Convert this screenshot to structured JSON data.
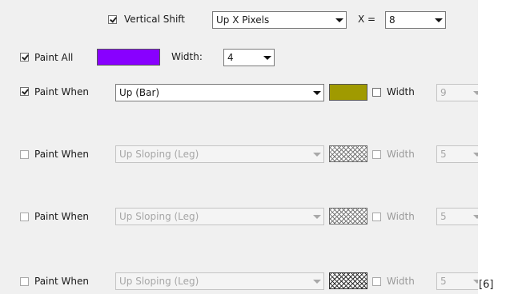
{
  "vertical_shift": {
    "checked": true,
    "label": "Vertical Shift",
    "direction_value": "Up X Pixels",
    "x_label": "X =",
    "x_value": "8"
  },
  "paint_all": {
    "checked": true,
    "label": "Paint All",
    "color": "#8800ff",
    "width_label": "Width:",
    "width_value": "4"
  },
  "rows": [
    {
      "checked": true,
      "label": "Paint When",
      "condition": "Up (Bar)",
      "color": "#a09a00",
      "width_checked": false,
      "width_label": "Width",
      "width_value": "9"
    },
    {
      "checked": false,
      "label": "Paint When",
      "condition": "Up Sloping (Leg)",
      "swatch": "hatched",
      "width_checked": false,
      "width_label": "Width",
      "width_value": "5"
    },
    {
      "checked": false,
      "label": "Paint When",
      "condition": "Up Sloping (Leg)",
      "swatch": "hatched",
      "width_checked": false,
      "width_label": "Width",
      "width_value": "5"
    },
    {
      "checked": false,
      "label": "Paint When",
      "condition": "Up Sloping (Leg)",
      "swatch": "hatched-dark",
      "width_checked": false,
      "width_label": "Width",
      "width_value": "5"
    }
  ],
  "footnote": "[6]"
}
